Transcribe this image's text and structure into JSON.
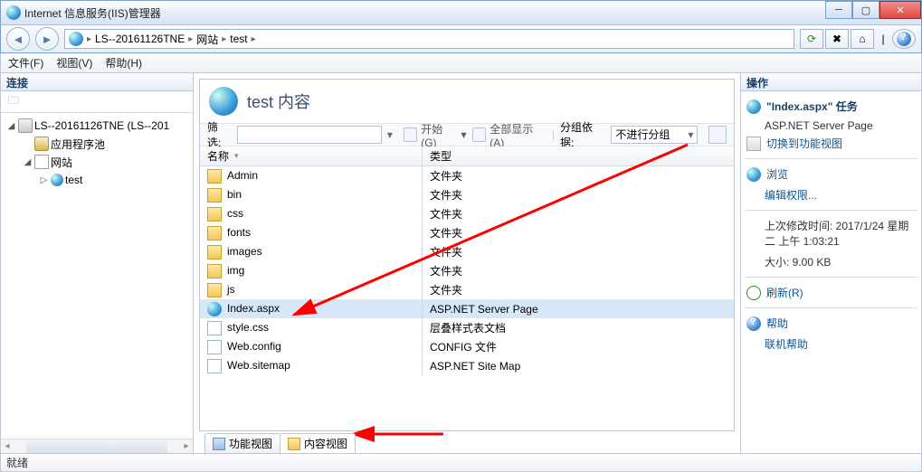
{
  "title": "Internet 信息服务(IIS)管理器",
  "nav": {
    "crumb1": "LS--20161126TNE",
    "crumb2": "网站",
    "crumb3": "test"
  },
  "menu": {
    "file": "文件(F)",
    "view": "视图(V)",
    "help": "帮助(H)"
  },
  "left": {
    "header": "连接",
    "nodes": {
      "server": "LS--20161126TNE (LS--201",
      "appPool": "应用程序池",
      "sites": "网站",
      "test": "test"
    }
  },
  "center": {
    "title": "test 内容",
    "filterLabel": "筛选:",
    "startLabel": "开始(G)",
    "showAll": "全部显示(A)",
    "groupLabel": "分组依据:",
    "groupValue": "不进行分组",
    "cols": {
      "name": "名称",
      "type": "类型"
    },
    "rows": [
      {
        "name": "Admin",
        "type": "文件夹",
        "icon": "fi-folder"
      },
      {
        "name": "bin",
        "type": "文件夹",
        "icon": "fi-folder"
      },
      {
        "name": "css",
        "type": "文件夹",
        "icon": "fi-folder"
      },
      {
        "name": "fonts",
        "type": "文件夹",
        "icon": "fi-folder"
      },
      {
        "name": "images",
        "type": "文件夹",
        "icon": "fi-folder"
      },
      {
        "name": "img",
        "type": "文件夹",
        "icon": "fi-folder"
      },
      {
        "name": "js",
        "type": "文件夹",
        "icon": "fi-folder"
      },
      {
        "name": "Index.aspx",
        "type": "ASP.NET Server Page",
        "icon": "fi-web",
        "selected": true
      },
      {
        "name": "style.css",
        "type": "层叠样式表文档",
        "icon": "fi-css"
      },
      {
        "name": "Web.config",
        "type": "CONFIG 文件",
        "icon": "fi-cfg"
      },
      {
        "name": "Web.sitemap",
        "type": "ASP.NET Site Map",
        "icon": "fi-map"
      }
    ],
    "tabFeat": "功能视图",
    "tabContent": "内容视图"
  },
  "right": {
    "header": "操作",
    "taskTitle": "\"Index.aspx\" 任务",
    "taskSub": "ASP.NET Server Page",
    "switchFeat": "切换到功能视图",
    "browse": "浏览",
    "editPerm": "编辑权限...",
    "lastMod": "上次修改时间: 2017/1/24 星期二 上午 1:03:21",
    "size": "大小: 9.00 KB",
    "refresh": "刷新(R)",
    "help": "帮助",
    "onlineHelp": "联机帮助"
  },
  "status": "就绪"
}
